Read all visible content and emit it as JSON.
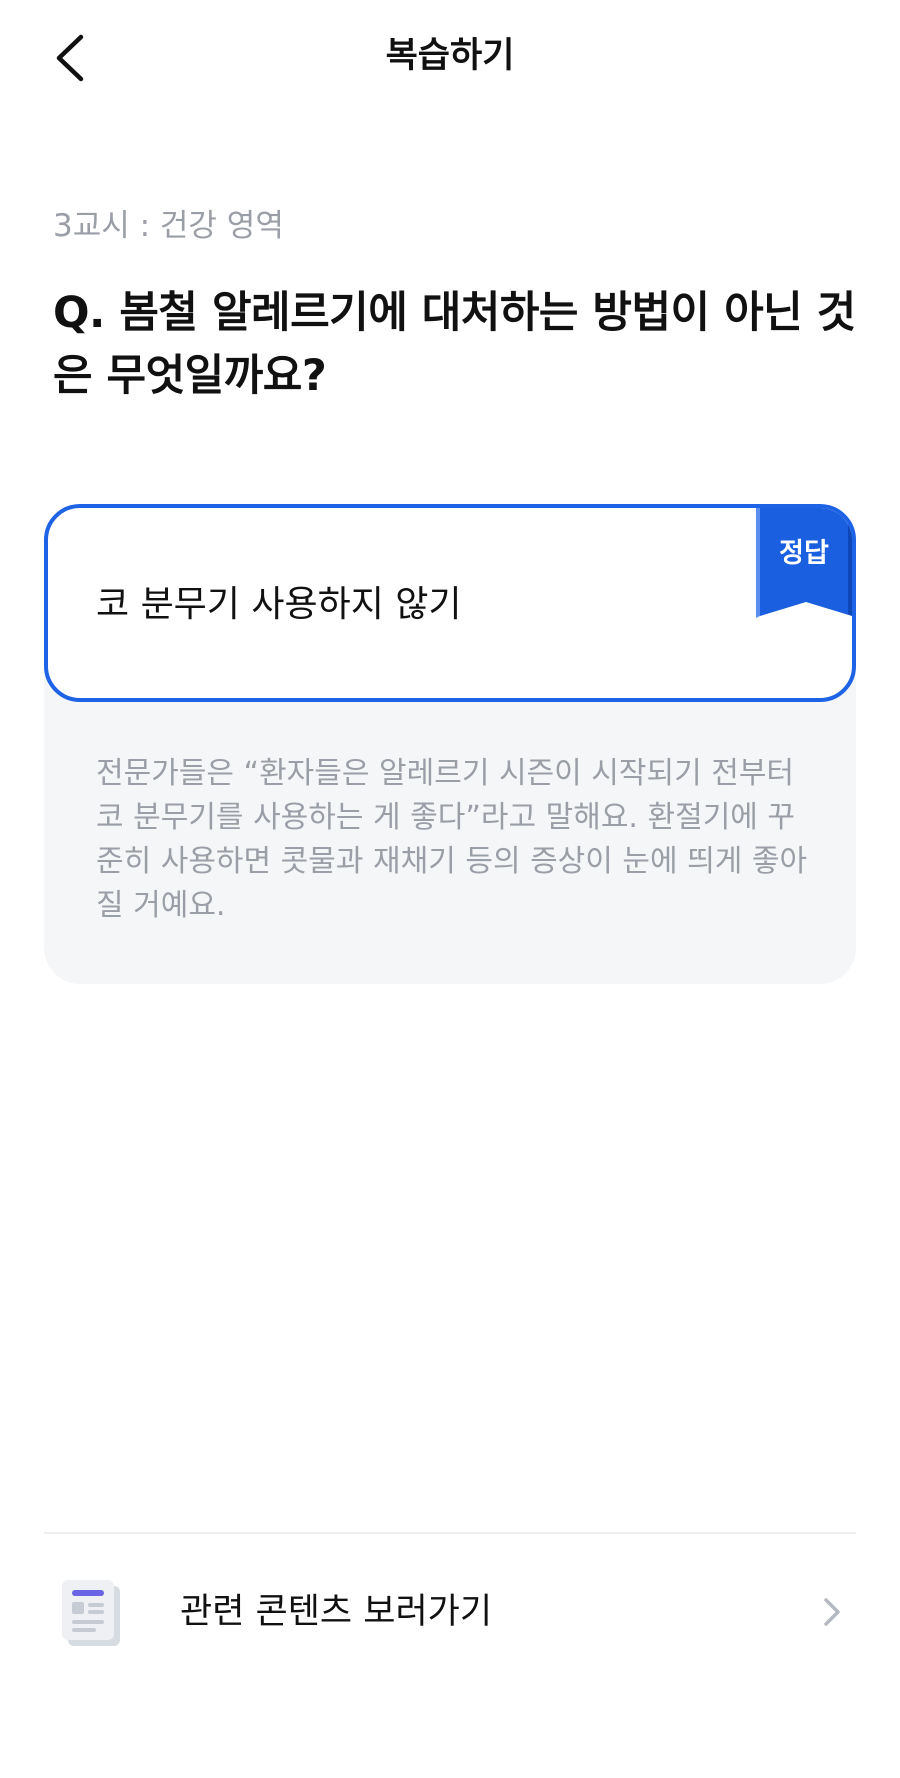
{
  "header": {
    "title": "복습하기",
    "back_icon": "chevron-left-icon"
  },
  "question": {
    "subject": "3교시 : 건강 영역",
    "text": "Q. 봄철 알레르기에 대처하는 방법이 아닌 것은 무엇일까요?"
  },
  "answer": {
    "text": "코 분무기 사용하지 않기",
    "badge": "정답",
    "explanation": "전문가들은 “환자들은 알레르기 시즌이 시작되기 전부터 코 분무기를 사용하는 게 좋다”라고 말해요. 환절기에 꾸준히 사용하면 콧물과 재채기 등의 증상이 눈에 띄게 좋아질 거예요."
  },
  "related": {
    "label": "관련 콘텐츠 보러가기",
    "icon": "document-icon",
    "chevron": "chevron-right-icon"
  },
  "colors": {
    "accent": "#1e63e6",
    "muted_text": "#9a9ea6",
    "card_bg": "#f5f6f8"
  }
}
